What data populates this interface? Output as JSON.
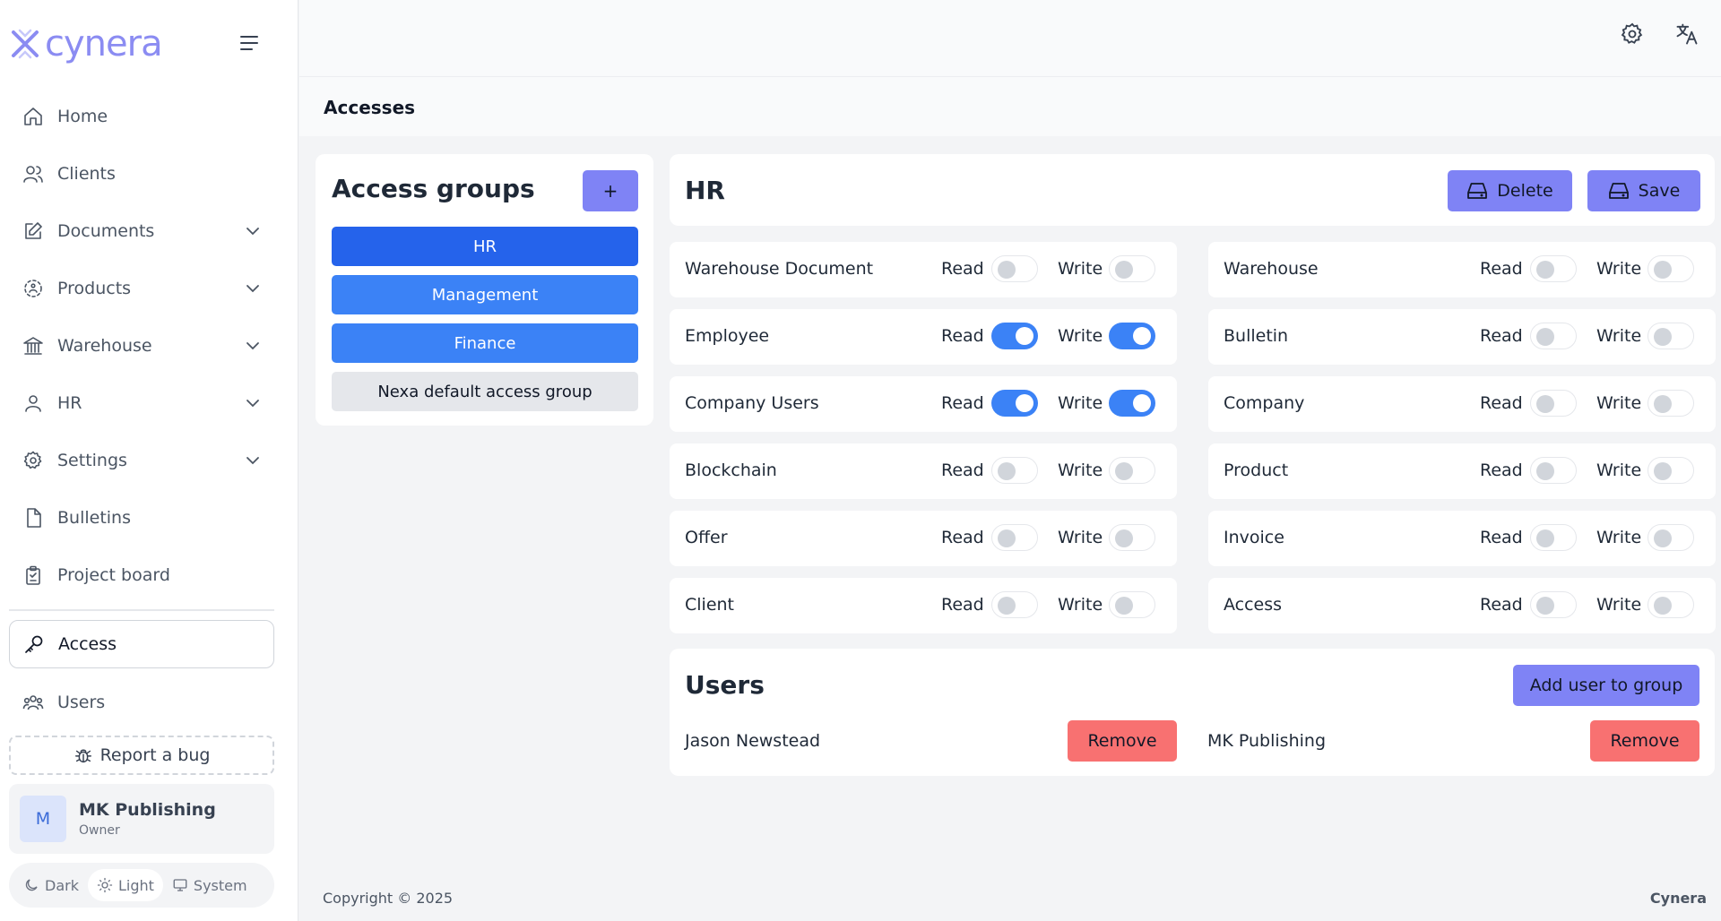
{
  "brand": {
    "name": "cynera",
    "accent": "#8b8cf2"
  },
  "sidebar": {
    "items": [
      {
        "label": "Home",
        "icon": "home-icon",
        "has_children": false
      },
      {
        "label": "Clients",
        "icon": "users-icon",
        "has_children": false
      },
      {
        "label": "Documents",
        "icon": "edit-icon",
        "has_children": true
      },
      {
        "label": "Products",
        "icon": "box-dashed-icon",
        "has_children": true
      },
      {
        "label": "Warehouse",
        "icon": "building-icon",
        "has_children": true
      },
      {
        "label": "HR",
        "icon": "person-icon",
        "has_children": true
      },
      {
        "label": "Settings",
        "icon": "gear-icon",
        "has_children": true
      },
      {
        "label": "Bulletins",
        "icon": "file-icon",
        "has_children": false
      },
      {
        "label": "Project board",
        "icon": "clipboard-icon",
        "has_children": false
      }
    ],
    "active_item": {
      "label": "Access",
      "icon": "key-icon"
    },
    "users_item": {
      "label": "Users",
      "icon": "group-icon"
    },
    "report_bug": "Report a bug",
    "profile": {
      "initial": "M",
      "name": "MK Publishing",
      "role": "Owner"
    },
    "theme": {
      "options": [
        "Dark",
        "Light",
        "System"
      ],
      "selected": "Light"
    }
  },
  "page": {
    "title": "Accesses"
  },
  "groups": {
    "title": "Access groups",
    "add_label": "+",
    "items": [
      {
        "label": "HR",
        "selected": true
      },
      {
        "label": "Management",
        "selected": false
      },
      {
        "label": "Finance",
        "selected": false
      },
      {
        "label": "Nexa default access group",
        "selected": false
      }
    ]
  },
  "detail": {
    "title": "HR",
    "delete_label": "Delete",
    "save_label": "Save",
    "read_label": "Read",
    "write_label": "Write",
    "permissions_left": [
      {
        "name": "Warehouse Document",
        "read": false,
        "write": false
      },
      {
        "name": "Employee",
        "read": true,
        "write": true
      },
      {
        "name": "Company Users",
        "read": true,
        "write": true
      },
      {
        "name": "Blockchain",
        "read": false,
        "write": false
      },
      {
        "name": "Offer",
        "read": false,
        "write": false
      },
      {
        "name": "Client",
        "read": false,
        "write": false
      }
    ],
    "permissions_right": [
      {
        "name": "Warehouse",
        "read": false,
        "write": false
      },
      {
        "name": "Bulletin",
        "read": false,
        "write": false
      },
      {
        "name": "Company",
        "read": false,
        "write": false
      },
      {
        "name": "Product",
        "read": false,
        "write": false
      },
      {
        "name": "Invoice",
        "read": false,
        "write": false
      },
      {
        "name": "Access",
        "read": false,
        "write": false
      }
    ]
  },
  "users": {
    "title": "Users",
    "add_label": "Add user to group",
    "remove_label": "Remove",
    "members": [
      "Jason Newstead",
      "MK Publishing"
    ]
  },
  "footer": {
    "copyright": "Copyright © 2025",
    "brand": "Cynera"
  },
  "colors": {
    "selected_group": "#2563eb",
    "group": "#3b82f6",
    "default_group": "#e5e7eb",
    "action_button": "#7f83f5",
    "remove_button": "#f87171",
    "toggle_on": "#3b82f6"
  }
}
